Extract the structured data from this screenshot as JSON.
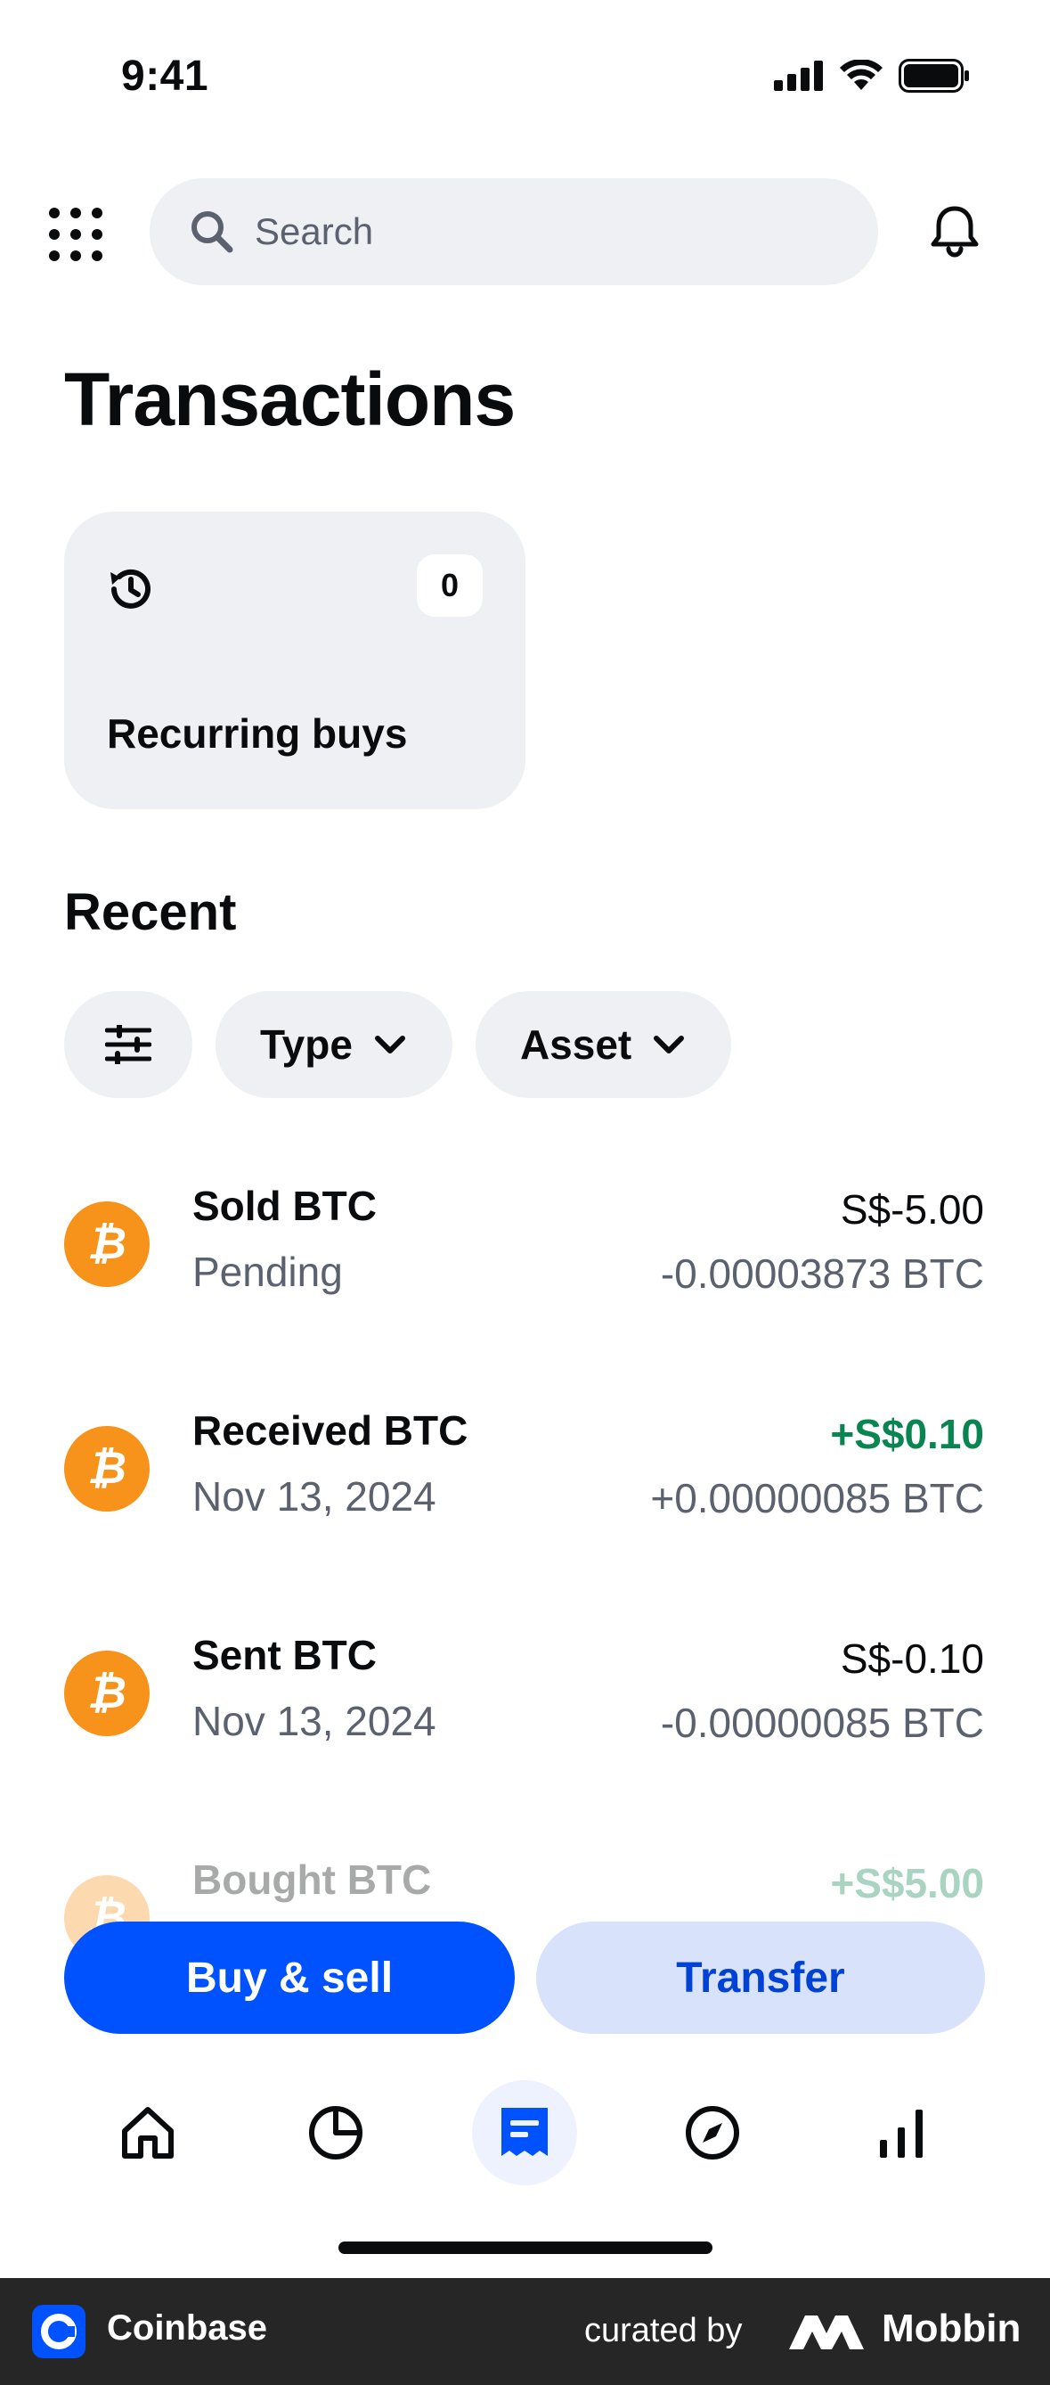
{
  "status_bar": {
    "time": "9:41"
  },
  "search": {
    "placeholder": "Search"
  },
  "page": {
    "title": "Transactions"
  },
  "recurring": {
    "label": "Recurring buys",
    "count": "0"
  },
  "recent": {
    "title": "Recent",
    "filters": {
      "type_label": "Type",
      "asset_label": "Asset"
    }
  },
  "transactions": [
    {
      "title": "Sold BTC",
      "subtitle": "Pending",
      "fiat": "S$-5.00",
      "crypto": "-0.00003873 BTC",
      "positive": false
    },
    {
      "title": "Received BTC",
      "subtitle": "Nov 13, 2024",
      "fiat": "+S$0.10",
      "crypto": "+0.00000085 BTC",
      "positive": true
    },
    {
      "title": "Sent BTC",
      "subtitle": "Nov 13, 2024",
      "fiat": "S$-0.10",
      "crypto": "-0.00000085 BTC",
      "positive": false
    },
    {
      "title": "Bought BTC",
      "subtitle": "",
      "fiat": "+S$5.00",
      "crypto": "",
      "positive": true
    }
  ],
  "actions": {
    "primary_label": "Buy & sell",
    "secondary_label": "Transfer"
  },
  "tabs": [
    {
      "icon": "home-icon",
      "active": false
    },
    {
      "icon": "portfolio-pie-icon",
      "active": false
    },
    {
      "icon": "transactions-receipt-icon",
      "active": true
    },
    {
      "icon": "explore-compass-icon",
      "active": false
    },
    {
      "icon": "markets-bars-icon",
      "active": false
    }
  ],
  "footer": {
    "app_name": "Coinbase",
    "curated_by": "curated by",
    "brand": "Mobbin"
  },
  "colors": {
    "accent": "#0052ff",
    "positive": "#098551",
    "bitcoin": "#f7931a",
    "chip_bg": "#eef0f3"
  }
}
